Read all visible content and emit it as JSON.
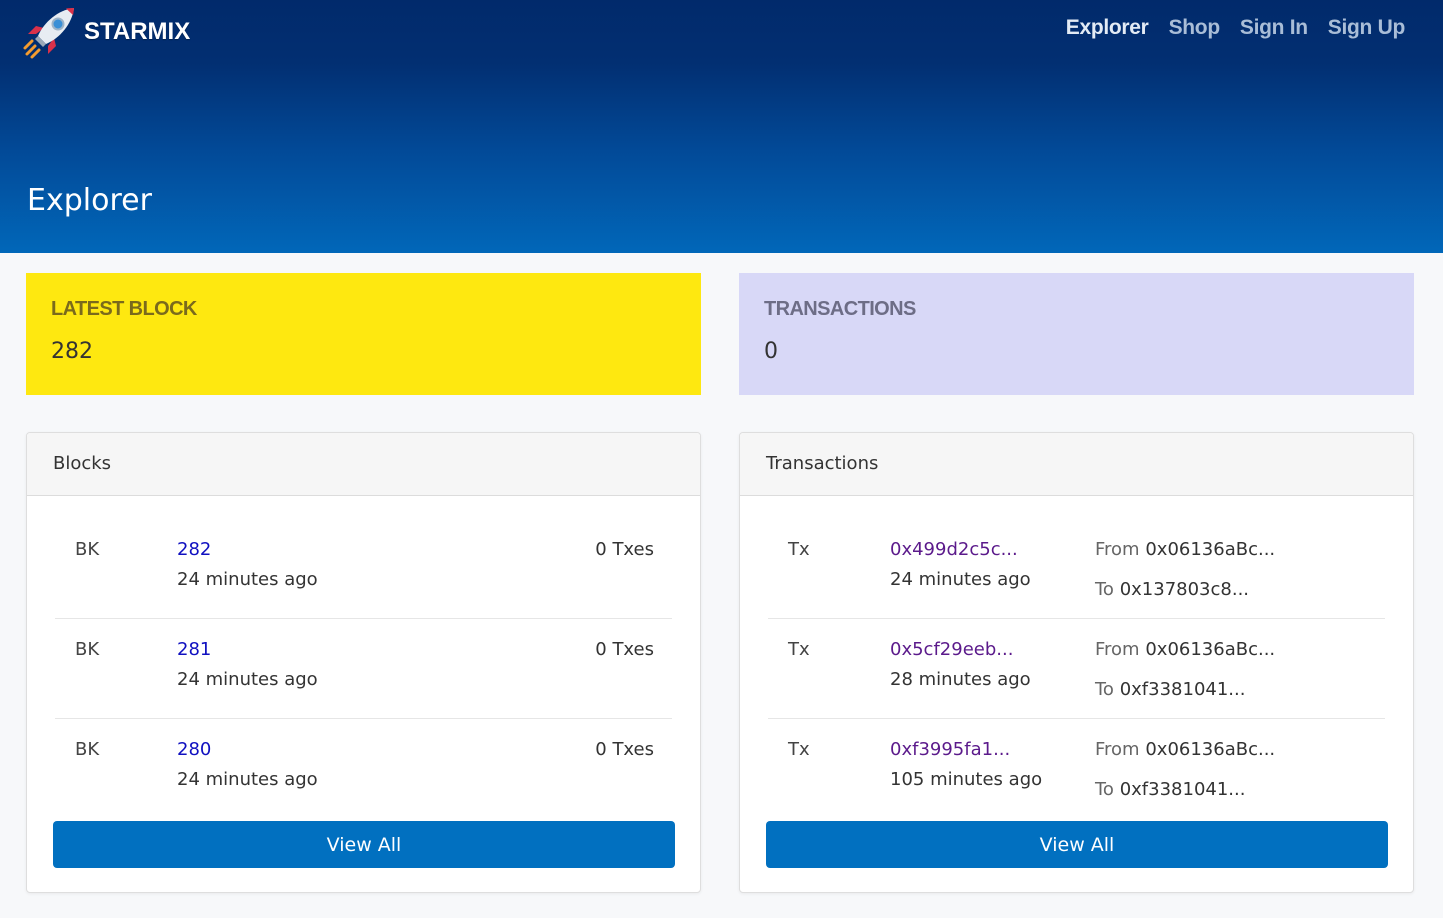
{
  "brand": {
    "name": "STARMIX",
    "logo_icon": "rocket-icon"
  },
  "nav": [
    {
      "label": "Explorer",
      "active": true
    },
    {
      "label": "Shop",
      "active": false
    },
    {
      "label": "Sign In",
      "active": false
    },
    {
      "label": "Sign Up",
      "active": false
    }
  ],
  "hero": {
    "title": "Explorer"
  },
  "stats": {
    "latest_block": {
      "label": "LATEST BLOCK",
      "value": "282",
      "color": "#fee810"
    },
    "transactions": {
      "label": "TRANSACTIONS",
      "value": "0",
      "color": "#d8d8f7"
    }
  },
  "blocks_card": {
    "title": "Blocks",
    "rows": [
      {
        "tag": "BK",
        "number": "282",
        "time": "24 minutes ago",
        "txes": "0 Txes"
      },
      {
        "tag": "BK",
        "number": "281",
        "time": "24 minutes ago",
        "txes": "0 Txes"
      },
      {
        "tag": "BK",
        "number": "280",
        "time": "24 minutes ago",
        "txes": "0 Txes"
      }
    ],
    "button_label": "View All"
  },
  "transactions_card": {
    "title": "Transactions",
    "from_label": "From",
    "to_label": "To",
    "rows": [
      {
        "tag": "Tx",
        "hash": "0x499d2c5c...",
        "time": "24 minutes ago",
        "from": "0x06136aBc...",
        "to": "0x137803c8..."
      },
      {
        "tag": "Tx",
        "hash": "0x5cf29eeb...",
        "time": "28 minutes ago",
        "from": "0x06136aBc...",
        "to": "0xf3381041..."
      },
      {
        "tag": "Tx",
        "hash": "0xf3995fa1...",
        "time": "105 minutes ago",
        "from": "0x06136aBc...",
        "to": "0xf3381041..."
      }
    ],
    "button_label": "View All"
  },
  "colors": {
    "accent": "#0170c0",
    "hero_top": "#012a6b",
    "hero_bottom": "#0167b9"
  }
}
